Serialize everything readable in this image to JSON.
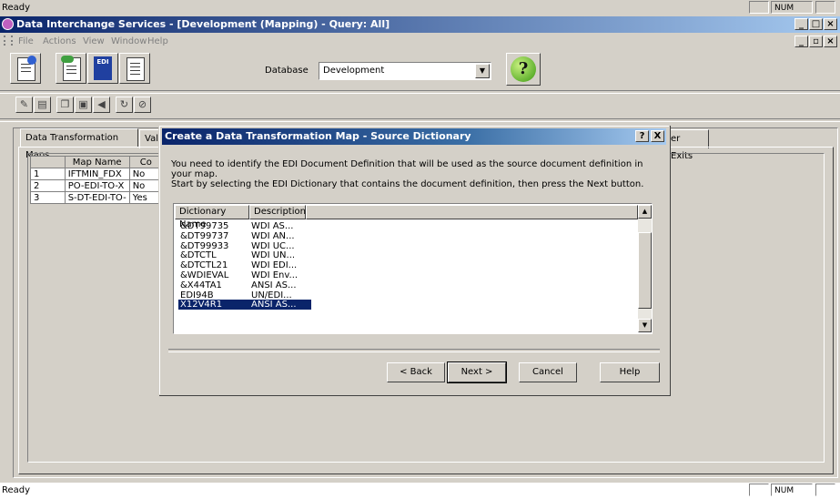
{
  "status_top": {
    "text": "Ready",
    "num": "NUM"
  },
  "window": {
    "title": "Data Interchange Services - [Development (Mapping) - Query: All]"
  },
  "menu": [
    "File",
    "Actions",
    "View",
    "Window",
    "Help"
  ],
  "toolbar": {
    "database_label": "Database",
    "database_value": "Development",
    "edi_icon_text": "EDI"
  },
  "tabs": [
    "Data Transformation Maps",
    "Val",
    "er Exits"
  ],
  "maps_grid": {
    "headers": [
      "",
      "Map Name",
      "Co"
    ],
    "rows": [
      [
        "1",
        "IFTMIN_FDX",
        "No"
      ],
      [
        "2",
        "PO-EDI-TO-X",
        "No"
      ],
      [
        "3",
        "S-DT-EDI-TO-",
        "Yes"
      ]
    ]
  },
  "dialog": {
    "title": "Create a Data Transformation Map - Source Dictionary",
    "help_glyph": "?",
    "close_glyph": "X",
    "instructions_1": "You need to identify the EDI Document Definition that will be used as the source document definition in your map.",
    "instructions_2": "Start by selecting the EDI Dictionary that contains the document definition, then press the Next button.",
    "list_headers": [
      "Dictionary Name",
      "Description"
    ],
    "list_rows": [
      [
        "&DT99735",
        "WDI AS..."
      ],
      [
        "&DT99737",
        "WDI AN..."
      ],
      [
        "&DT99933",
        "WDI UC..."
      ],
      [
        "&DTCTL",
        "WDI UN..."
      ],
      [
        "&DTCTL21",
        "WDI EDI..."
      ],
      [
        "&WDIEVAL",
        "WDI Env..."
      ],
      [
        "&X44TA1",
        "ANSI AS..."
      ],
      [
        "EDI94B",
        "UN/EDI..."
      ],
      [
        "X12V4R1",
        "ANSI AS..."
      ]
    ],
    "selected_row": 8,
    "buttons": {
      "back": "< Back",
      "next": "Next >",
      "cancel": "Cancel",
      "help": "Help"
    }
  },
  "status_bottom": {
    "text": "Ready",
    "num": "NUM"
  }
}
